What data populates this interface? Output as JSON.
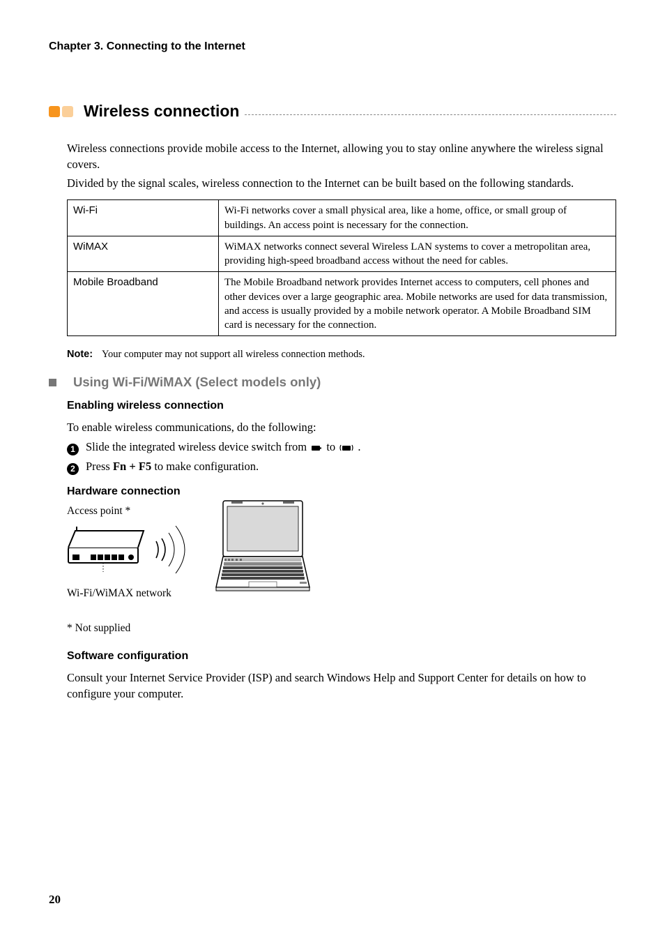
{
  "chapter_header": "Chapter 3. Connecting to the Internet",
  "section": {
    "title": "Wireless connection"
  },
  "intro_p1": "Wireless connections provide mobile access to the Internet, allowing you to stay online anywhere the wireless signal covers.",
  "intro_p2": "Divided by the signal scales, wireless connection to the Internet can be built based on the following standards.",
  "table": {
    "rows": [
      {
        "left": "Wi-Fi",
        "right": "Wi-Fi networks cover a small physical area, like a home, office, or small group of buildings. An access point is necessary for the connection."
      },
      {
        "left": "WiMAX",
        "right": "WiMAX networks connect several Wireless LAN systems to cover a metropolitan area, providing high-speed broadband access without the need for cables."
      },
      {
        "left": "Mobile Broadband",
        "right": "The Mobile Broadband network provides Internet access to computers, cell phones and other devices over a large geographic area. Mobile networks are used for data transmission, and access is usually provided by a mobile network operator. A Mobile Broadband SIM card is necessary for the connection."
      }
    ]
  },
  "note": {
    "label": "Note:",
    "text": "Your computer may not support all wireless connection methods."
  },
  "subsection": {
    "title": "Using Wi-Fi/WiMAX (Select models only)"
  },
  "h3_enable": "Enabling wireless connection",
  "enable_intro": "To enable wireless communications, do the following:",
  "step1_a": "Slide the integrated wireless device switch from ",
  "step1_b": " to ",
  "step1_c": ".",
  "step2_a": "Press ",
  "step2_key": "Fn + F5",
  "step2_b": " to make configuration.",
  "h3_hw": "Hardware connection",
  "diagram": {
    "ap_label": "Access point *",
    "net_label": "Wi-Fi/WiMAX network"
  },
  "footnote": "* Not supplied",
  "h3_sw": "Software configuration",
  "sw_text": "Consult your Internet Service Provider (ISP) and search Windows Help and Support Center for details on how to configure your computer.",
  "icon_names": {
    "off": "wireless-off-icon",
    "on": "wireless-on-icon"
  },
  "page_number": "20"
}
